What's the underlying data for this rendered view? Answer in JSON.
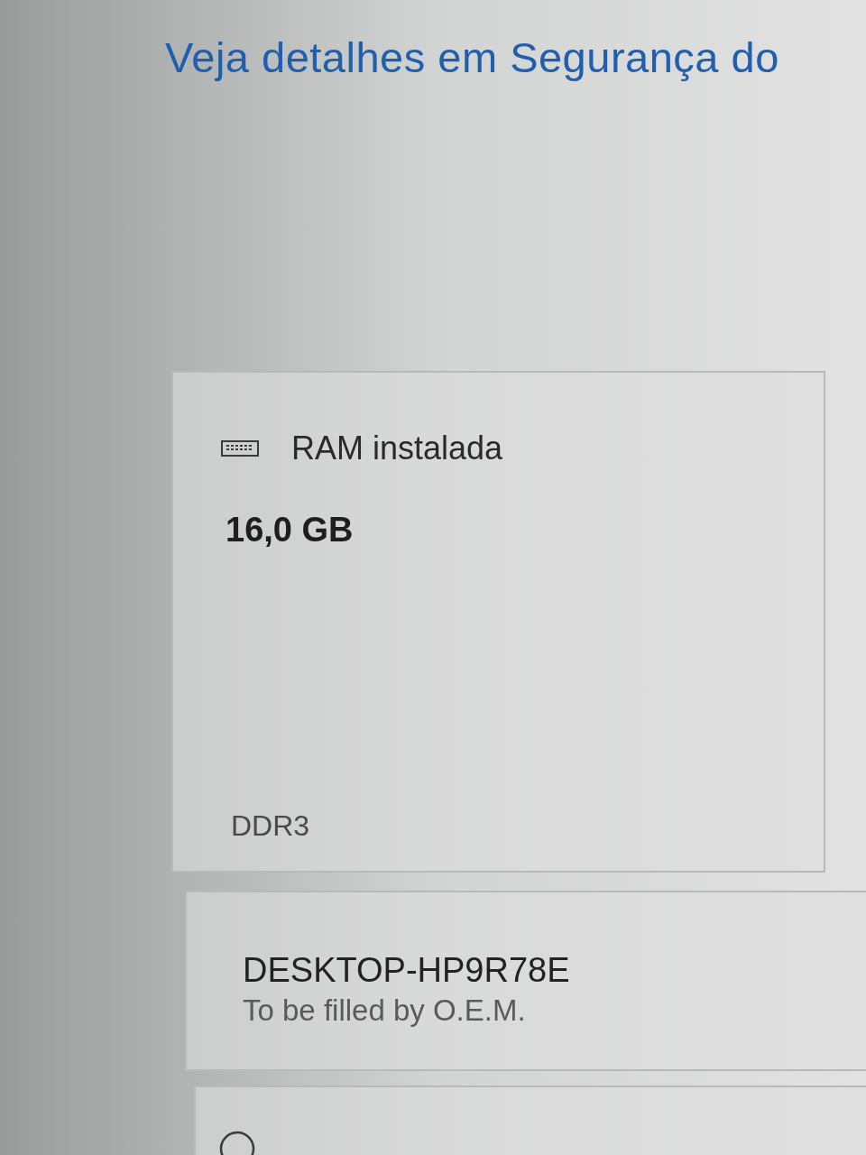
{
  "link": {
    "text": "Veja detalhes em Segurança do"
  },
  "cards": [
    {
      "kind": "spec",
      "title": "RAM instalada",
      "value": "16,0 GB",
      "detail": "DDR3"
    },
    {
      "kind": "device",
      "name": "DESKTOP-HP9R78E",
      "subtitle": "To be filled by O.E.M."
    },
    {
      "kind": "ring"
    }
  ]
}
